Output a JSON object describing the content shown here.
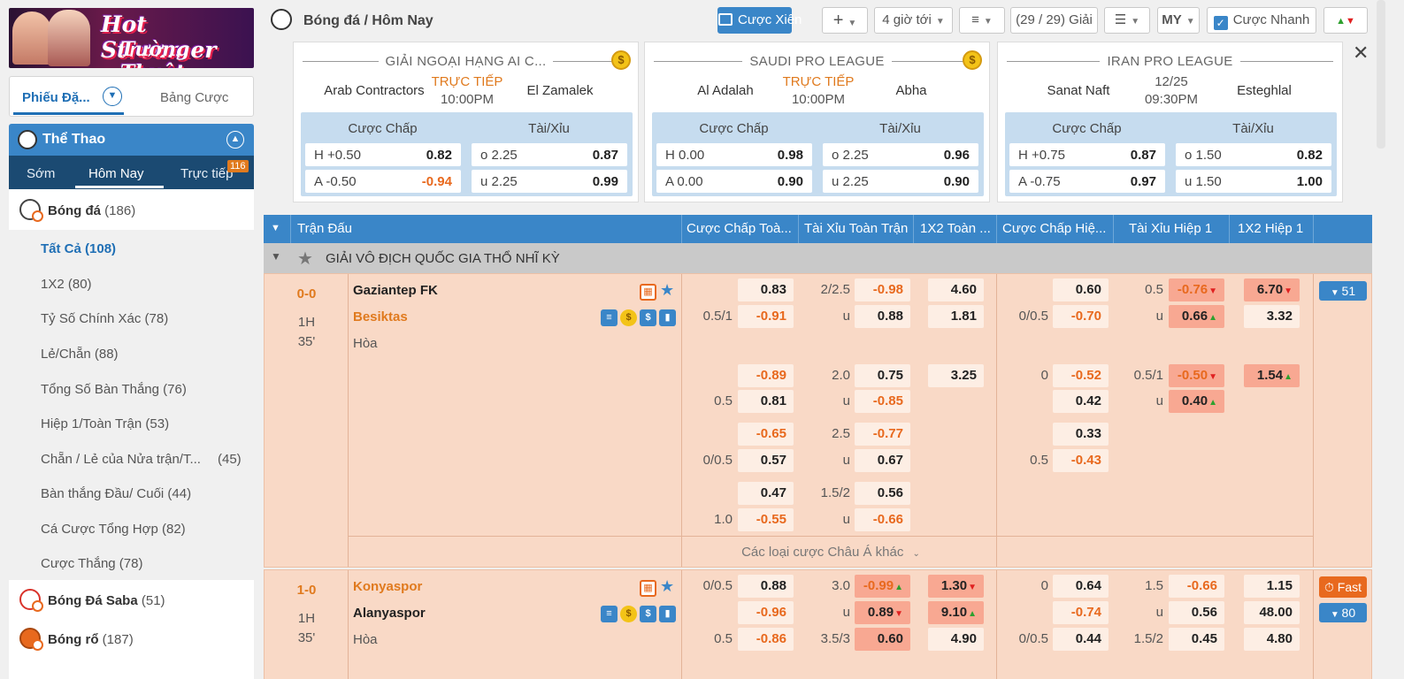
{
  "banner": {
    "line1": "Hot Streamer",
    "line2": "Tường Thuật"
  },
  "ticket_tabs": {
    "ticket": "Phiếu Đặ...",
    "board": "Bảng Cược"
  },
  "sports": {
    "title": "Thể Thao",
    "tabs": {
      "early": "Sớm",
      "today": "Hôm Nay",
      "live": "Trực tiếp",
      "live_count": "116"
    }
  },
  "sport_list": [
    {
      "name": "Bóng đá",
      "count": "(186)"
    },
    {
      "name": "Bóng Đá Saba",
      "count": "(51)"
    },
    {
      "name": "Bóng rổ",
      "count": "(187)"
    }
  ],
  "sub_items": [
    {
      "label": "Tất Cả (108)"
    },
    {
      "label": "1X2 (80)"
    },
    {
      "label": "Tỷ Số Chính Xác (78)"
    },
    {
      "label": "Lẻ/Chẵn (88)"
    },
    {
      "label": "Tổng Số Bàn Thắng (76)"
    },
    {
      "label": "Hiệp 1/Toàn Trận (53)"
    },
    {
      "label": "Chẵn / Lẻ của Nửa trận/T...",
      "count": "(45)"
    },
    {
      "label": "Bàn thắng Đầu/ Cuối (44)"
    },
    {
      "label": "Cá Cược Tổng Hợp (82)"
    },
    {
      "label": "Cược Thắng (78)"
    }
  ],
  "topbar": {
    "breadcrumb": "Bóng đá / Hôm Nay",
    "parlay": "Cược Xiên",
    "add": "+",
    "time": "4 giờ tới",
    "leagues": "(29 / 29) Giải",
    "odds_type": "MY",
    "quick_bet": "Cược Nhanh"
  },
  "featured": [
    {
      "league": "GIẢI NGOẠI HẠNG AI C...",
      "home": "Arab Contractors",
      "away": "El Zamalek",
      "status": "TRỰC TIẾP",
      "time": "10:00PM",
      "hcap_label": "Cược Chấp",
      "ou_label": "Tài/Xỉu",
      "h_line": "H +0.50",
      "h_odds": "0.82",
      "a_line": "A -0.50",
      "a_odds": "-0.94",
      "o_line": "o 2.25",
      "o_odds": "0.87",
      "u_line": "u 2.25",
      "u_odds": "0.99"
    },
    {
      "league": "SAUDI PRO LEAGUE",
      "home": "Al Adalah",
      "away": "Abha",
      "status": "TRỰC TIẾP",
      "time": "10:00PM",
      "hcap_label": "Cược Chấp",
      "ou_label": "Tài/Xỉu",
      "h_line": "H 0.00",
      "h_odds": "0.98",
      "a_line": "A 0.00",
      "a_odds": "0.90",
      "o_line": "o 2.25",
      "o_odds": "0.96",
      "u_line": "u 2.25",
      "u_odds": "0.90"
    },
    {
      "league": "IRAN PRO LEAGUE",
      "home": "Sanat Naft",
      "away": "Esteghlal",
      "status": "12/25",
      "time": "09:30PM",
      "hcap_label": "Cược Chấp",
      "ou_label": "Tài/Xỉu",
      "h_line": "H +0.75",
      "h_odds": "0.87",
      "a_line": "A -0.75",
      "a_odds": "0.97",
      "o_line": "o 1.50",
      "o_odds": "0.82",
      "u_line": "u 1.50",
      "u_odds": "1.00"
    }
  ],
  "table": {
    "headers": [
      "Trận Đấu",
      "Cược Chấp Toà...",
      "Tài Xỉu Toàn Trận",
      "1X2 Toàn ...",
      "Cược Chấp Hiệ...",
      "Tài Xỉu Hiệp 1",
      "1X2 Hiệp 1"
    ],
    "league": "GIẢI VÔ ĐỊCH QUỐC GIA THỔ NHĨ KỲ",
    "more_asian": "Các loại cược Châu Á khác",
    "m1": {
      "score": "0-0",
      "period": "1H",
      "minute": "35'",
      "home": "Gaziantep FK",
      "away": "Besiktas",
      "draw": "Hòa",
      "more": "51",
      "hc": [
        [
          "",
          "0.83"
        ],
        [
          "0.5/1",
          "-0.91"
        ],
        [
          "",
          "-0.89"
        ],
        [
          "0.5",
          "0.81"
        ],
        [
          "",
          "-0.65"
        ],
        [
          "0/0.5",
          "0.57"
        ],
        [
          "",
          "0.47"
        ],
        [
          "1.0",
          "-0.55"
        ]
      ],
      "ou": [
        [
          "2/2.5",
          "-0.98"
        ],
        [
          "u",
          "0.88"
        ],
        [
          "2.0",
          "0.75"
        ],
        [
          "u",
          "-0.85"
        ],
        [
          "2.5",
          "-0.77"
        ],
        [
          "u",
          "0.67"
        ],
        [
          "1.5/2",
          "0.56"
        ],
        [
          "u",
          "-0.66"
        ]
      ],
      "x12": [
        "4.60",
        "1.81",
        "3.25"
      ],
      "h1hc": [
        [
          "",
          "0.60"
        ],
        [
          "0/0.5",
          "-0.70"
        ],
        [
          "0",
          "-0.52"
        ],
        [
          "",
          "0.42"
        ],
        [
          "",
          "0.33"
        ],
        [
          "0.5",
          "-0.43"
        ]
      ],
      "h1ou": [
        [
          "0.5",
          "-0.76"
        ],
        [
          "u",
          "0.66"
        ],
        [
          "0.5/1",
          "-0.50"
        ],
        [
          "u",
          "0.40"
        ]
      ],
      "h1x12": [
        "6.70",
        "3.32",
        "1.54"
      ]
    },
    "m2": {
      "score": "1-0",
      "period": "1H",
      "minute": "35'",
      "home": "Konyaspor",
      "away": "Alanyaspor",
      "draw": "Hòa",
      "more": "80",
      "fast": "Fast",
      "hc": [
        [
          "0/0.5",
          "0.88"
        ],
        [
          "",
          "-0.96"
        ],
        [
          "0.5",
          "-0.86"
        ]
      ],
      "ou": [
        [
          "3.0",
          "-0.99"
        ],
        [
          "u",
          "0.89"
        ],
        [
          "3.5/3",
          "0.60"
        ]
      ],
      "x12": [
        "1.30",
        "9.10",
        "4.90"
      ],
      "h1hc": [
        [
          "0",
          "0.64"
        ],
        [
          "",
          "-0.74"
        ],
        [
          "0/0.5",
          "0.44"
        ]
      ],
      "h1ou": [
        [
          "1.5",
          "-0.66"
        ],
        [
          "u",
          "0.56"
        ],
        [
          "1.5/2",
          "0.45"
        ]
      ],
      "h1x12": [
        "1.15",
        "48.00",
        "4.80"
      ]
    }
  },
  "colors": {
    "primary": "#3a86c8",
    "accent": "#e8691e",
    "row_bg": "#f9d9c6",
    "hot_odds": "#f8a892"
  }
}
